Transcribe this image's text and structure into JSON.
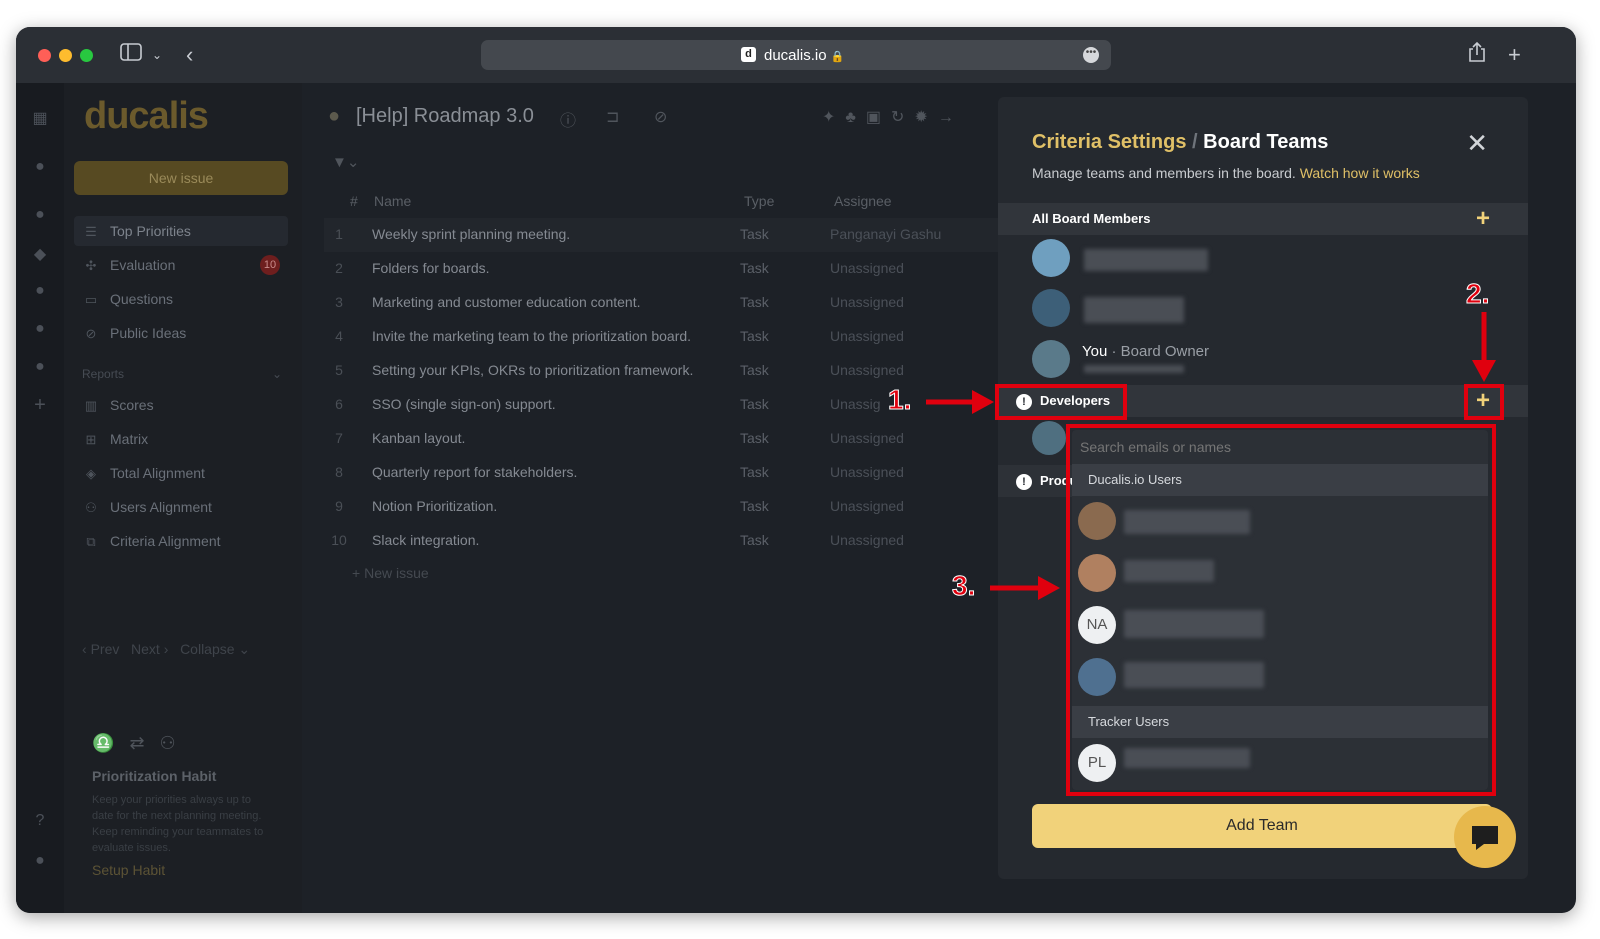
{
  "browser": {
    "favicon_letter": "d",
    "host": "ducalis.io",
    "lock_icon": "🔒"
  },
  "sidebar": {
    "logo": "ducalis",
    "new_issue": "New issue",
    "items": [
      {
        "label": "Top Priorities",
        "icon": "list-icon"
      },
      {
        "label": "Evaluation",
        "icon": "evaluation-icon",
        "badge": "10"
      },
      {
        "label": "Questions",
        "icon": "questions-icon"
      },
      {
        "label": "Public Ideas",
        "icon": "public-ideas-icon"
      }
    ],
    "reports_label": "Reports",
    "reports": [
      {
        "label": "Scores",
        "icon": "scores-icon"
      },
      {
        "label": "Matrix",
        "icon": "matrix-icon"
      },
      {
        "label": "Total Alignment",
        "icon": "alignment-icon"
      },
      {
        "label": "Users Alignment",
        "icon": "users-alignment-icon"
      },
      {
        "label": "Criteria Alignment",
        "icon": "criteria-alignment-icon"
      }
    ],
    "pager": {
      "prev": "Prev",
      "next": "Next",
      "collapse": "Collapse"
    },
    "habit": {
      "title": "Prioritization Habit",
      "text": "Keep your priorities always up to date for the next planning meeting. Keep reminding your teammates to evaluate issues.",
      "link": "Setup Habit"
    }
  },
  "board": {
    "title": "[Help] Roadmap 3.0",
    "columns": {
      "num": "#",
      "name": "Name",
      "type": "Type",
      "assignee": "Assignee"
    },
    "rows": [
      {
        "num": "1",
        "name": "Weekly sprint planning meeting.",
        "type": "Task",
        "assignee": "Panganayi Gashu"
      },
      {
        "num": "2",
        "name": "Folders for boards.",
        "type": "Task",
        "assignee": "Unassigned"
      },
      {
        "num": "3",
        "name": "Marketing and customer education content.",
        "type": "Task",
        "assignee": "Unassigned"
      },
      {
        "num": "4",
        "name": "Invite the marketing team to the prioritization board.",
        "type": "Task",
        "assignee": "Unassigned"
      },
      {
        "num": "5",
        "name": "Setting your KPIs, OKRs to prioritization framework.",
        "type": "Task",
        "assignee": "Unassigned"
      },
      {
        "num": "6",
        "name": "SSO (single sign-on) support.",
        "type": "Task",
        "assignee": "Unassig"
      },
      {
        "num": "7",
        "name": "Kanban layout.",
        "type": "Task",
        "assignee": "Unassigned"
      },
      {
        "num": "8",
        "name": "Quarterly report for stakeholders.",
        "type": "Task",
        "assignee": "Unassigned"
      },
      {
        "num": "9",
        "name": "Notion Prioritization.",
        "type": "Task",
        "assignee": "Unassigned"
      },
      {
        "num": "10",
        "name": "Slack integration.",
        "type": "Task",
        "assignee": "Unassigned"
      }
    ],
    "new_issue": "New issue"
  },
  "panel": {
    "title_part1": "Criteria Settings",
    "title_sep": "/",
    "title_part2": "Board Teams",
    "subtitle": "Manage teams and members in the board.",
    "watch_link": "Watch how it works",
    "all_members_label": "All Board Members",
    "you_label": "You",
    "owner_label": "· Board Owner",
    "team1": "Developers",
    "team2_partial": "Produ",
    "add_team": "Add Team"
  },
  "dropdown": {
    "search_placeholder": "Search emails or names",
    "section_ducalis": "Ducalis.io Users",
    "section_tracker": "Tracker Users",
    "initials_na": "NA",
    "initials_pl": "PL"
  },
  "annotations": {
    "a1": "1.",
    "a2": "2.",
    "a3": "3."
  },
  "colors": {
    "accent": "#e0c067",
    "button": "#f1d27a",
    "annotation": "#e0000e"
  }
}
